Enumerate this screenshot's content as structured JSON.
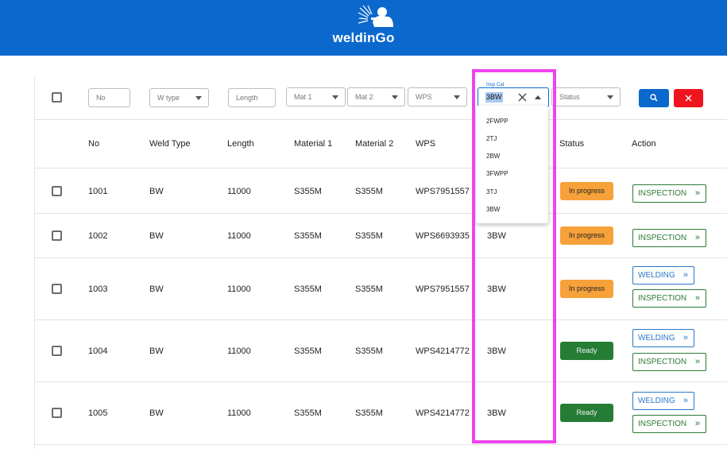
{
  "header": {
    "brand": "weldinGo"
  },
  "filters": {
    "no_placeholder": "No",
    "wtype_placeholder": "W type",
    "length_placeholder": "Length",
    "mat1_placeholder": "Mat 1",
    "mat2_placeholder": "Mat 2",
    "wps_placeholder": "WPS",
    "insp_label": "Insp Cat",
    "insp_value": "3BW",
    "status_placeholder": "Status"
  },
  "columns": {
    "no": "No",
    "weld_type": "Weld Type",
    "length": "Length",
    "material1": "Material 1",
    "material2": "Material 2",
    "wps": "WPS",
    "status": "Status",
    "action": "Action"
  },
  "dropdown_options": [
    "2FWPP",
    "2TJ",
    "2BW",
    "3FWPP",
    "3TJ",
    "3BW"
  ],
  "rows": [
    {
      "no": "1001",
      "weld_type": "BW",
      "length": "11000",
      "material1": "S355M",
      "material2": "S355M",
      "wps": "WPS7951557",
      "insp": "",
      "status": "In progress",
      "actions": [
        "INSPECTION"
      ]
    },
    {
      "no": "1002",
      "weld_type": "BW",
      "length": "11000",
      "material1": "S355M",
      "material2": "S355M",
      "wps": "WPS6693935",
      "insp": "3BW",
      "status": "In progress",
      "actions": [
        "INSPECTION"
      ]
    },
    {
      "no": "1003",
      "weld_type": "BW",
      "length": "11000",
      "material1": "S355M",
      "material2": "S355M",
      "wps": "WPS7951557",
      "insp": "3BW",
      "status": "In progress",
      "actions": [
        "WELDING",
        "INSPECTION"
      ]
    },
    {
      "no": "1004",
      "weld_type": "BW",
      "length": "11000",
      "material1": "S355M",
      "material2": "S355M",
      "wps": "WPS4214772",
      "insp": "3BW",
      "status": "Ready",
      "actions": [
        "WELDING",
        "INSPECTION"
      ]
    },
    {
      "no": "1005",
      "weld_type": "BW",
      "length": "11000",
      "material1": "S355M",
      "material2": "S355M",
      "wps": "WPS4214772",
      "insp": "3BW",
      "status": "Ready",
      "actions": [
        "WELDING",
        "INSPECTION"
      ]
    }
  ],
  "icons": {
    "logo": "welder-icon",
    "search": "search-icon",
    "clear": "close-icon",
    "chevrons": "double-chevron-right-icon"
  },
  "colors": {
    "primary": "#0b68cc",
    "danger": "#f0141e",
    "in_progress": "#f7a13a",
    "ready": "#257d35",
    "highlight": "#ee44ee"
  }
}
